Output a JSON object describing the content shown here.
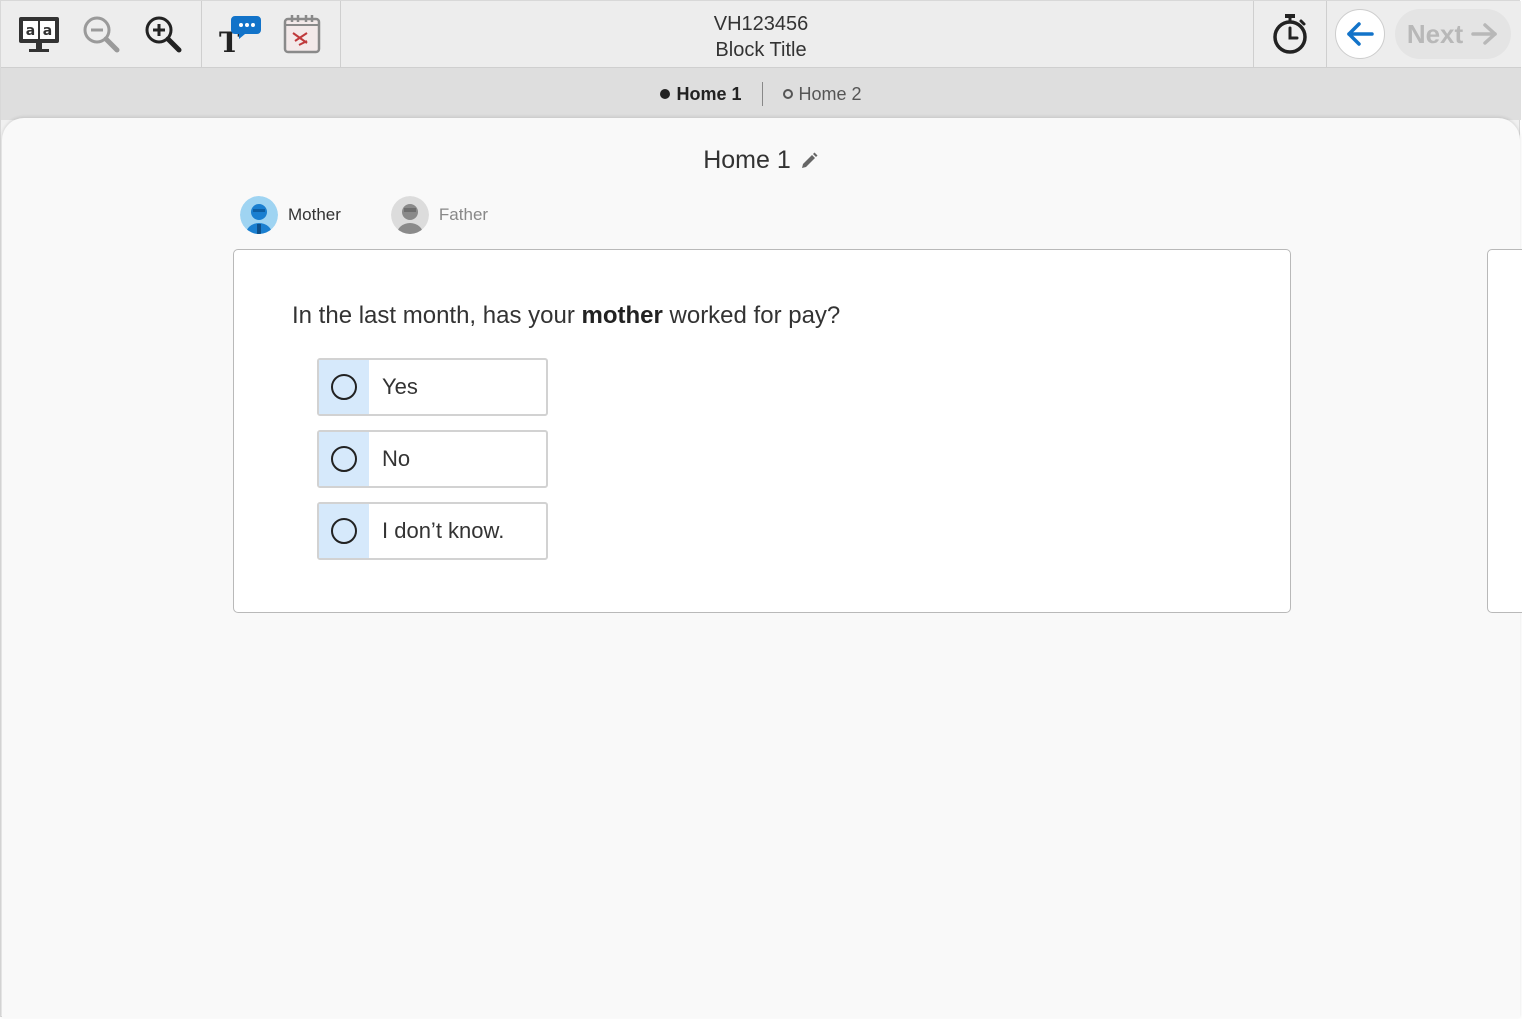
{
  "header": {
    "id_line": "VH123456",
    "block_title": "Block Title"
  },
  "toolbar": {
    "tools": [
      "translate-icon",
      "zoom-out-icon",
      "zoom-in-icon",
      "text-speech-icon",
      "calendar-icon"
    ],
    "next_label": "Next"
  },
  "subtabs": [
    {
      "label": "Home 1",
      "active": true
    },
    {
      "label": "Home 2",
      "active": false
    }
  ],
  "page": {
    "title": "Home 1"
  },
  "persons": [
    {
      "label": "Mother",
      "active": true
    },
    {
      "label": "Father",
      "active": false
    }
  ],
  "question": {
    "prefix": "In the last month, has your ",
    "emphasis": "mother",
    "suffix": " worked for pay?",
    "options": [
      "Yes",
      "No",
      "I don’t know."
    ]
  },
  "colors": {
    "accent_blue": "#1273c9",
    "option_radio_bg": "#d6e9fb"
  }
}
